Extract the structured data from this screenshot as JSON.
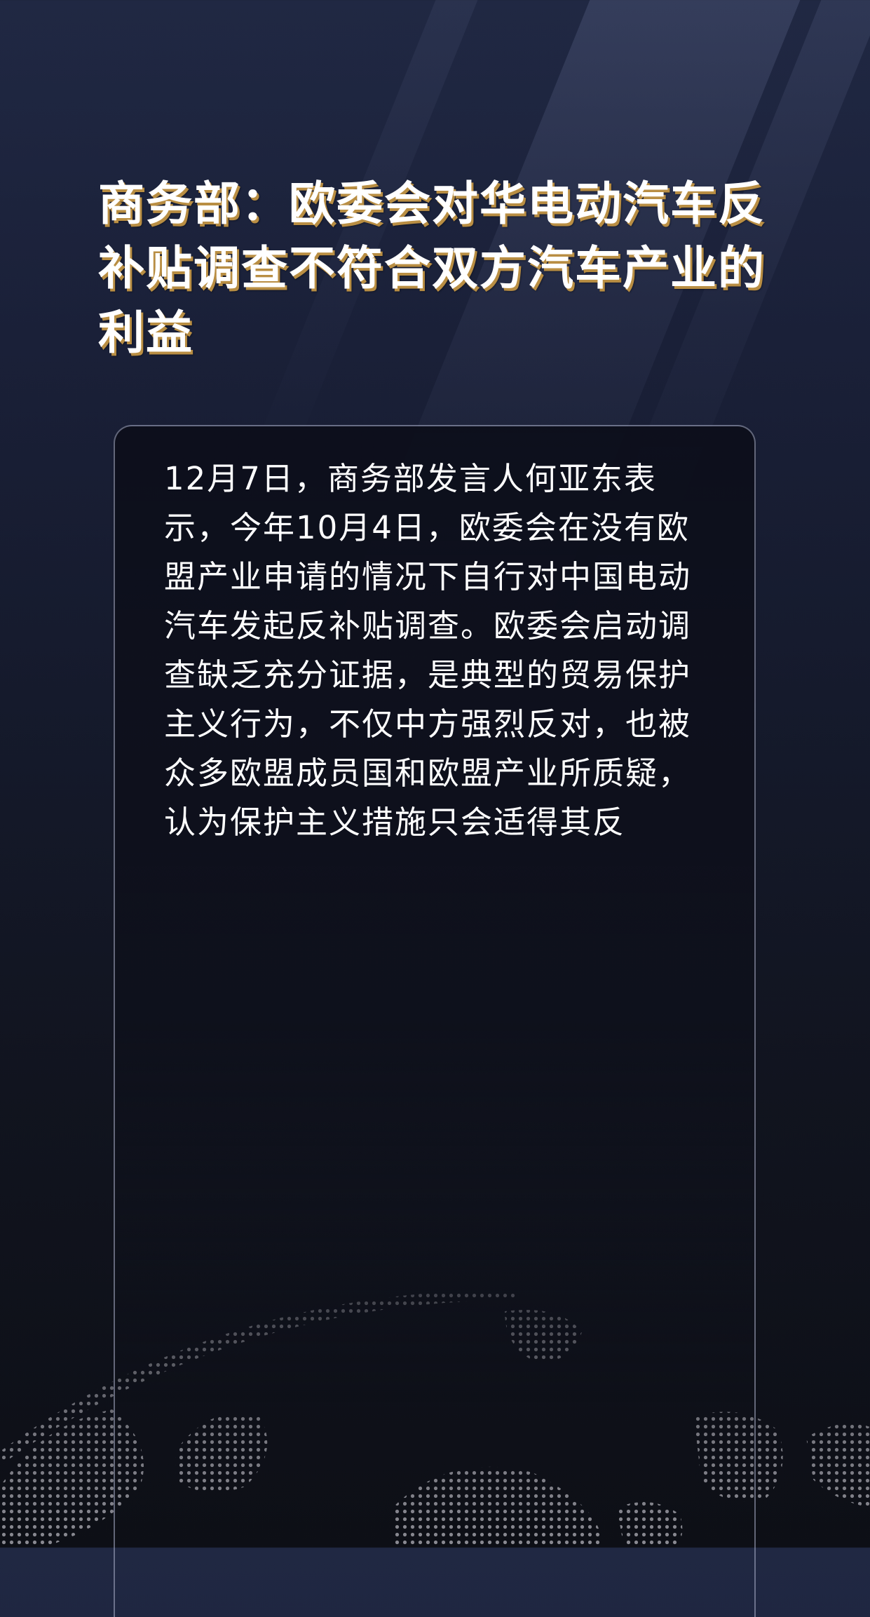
{
  "headline": "商务部：欧委会对华电动汽车反补贴调查不符合双方汽车产业的利益",
  "card": {
    "body": "12月7日，商务部发言人何亚东表示，今年10月4日，欧委会在没有欧盟产业申请的情况下自行对中国电动汽车发起反补贴调查。欧委会启动调查缺乏充分证据，是典型的贸易保护主义行为，不仅中方强烈反对，也被众多欧盟成员国和欧盟产业所质疑，认为保护主义措施只会适得其反"
  },
  "background": {
    "base_color": "#151a2c",
    "beam_color": "#7882aa",
    "title_shadow_color": "#b98e43",
    "globe_dot_color": "#8a8a92",
    "decoration_icon": "dotted-globe-icon"
  }
}
